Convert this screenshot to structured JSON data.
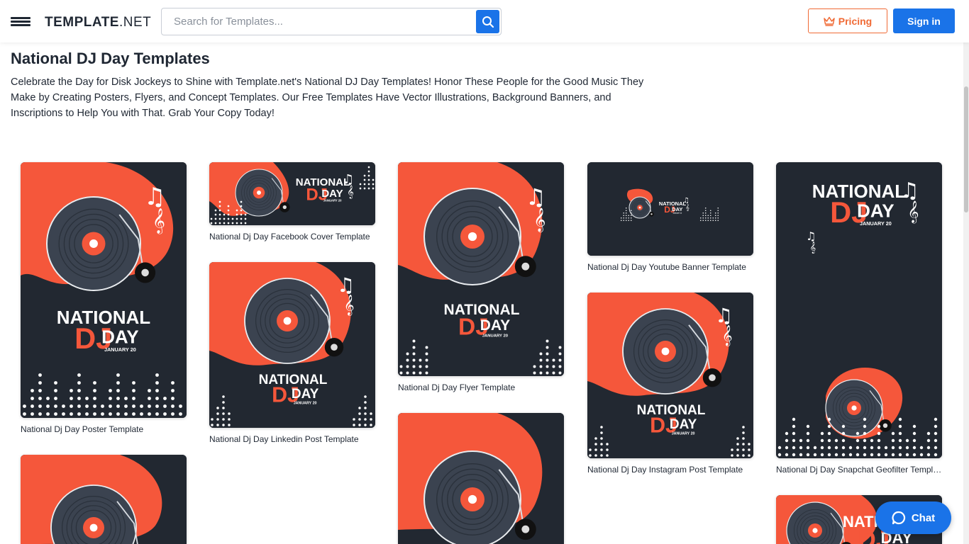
{
  "header": {
    "logo_main": "TEMPLATE",
    "logo_suffix": ".NET",
    "search_placeholder": "Search for Templates...",
    "pricing_label": "Pricing",
    "signin_label": "Sign in"
  },
  "page": {
    "title": "National DJ Day Templates",
    "description": "Celebrate the Day for Disk Jockeys to Shine with Template.net's National DJ Day Templates! Honor These People for the Good Music They Make by Creating Posters, Flyers, and Concept Templates. Our Free Templates Have Vector Illustrations, Background Banners, and Inscriptions to Help You with That. Grab Your Copy Today!"
  },
  "thumb_text": {
    "line1": "NATIONAL",
    "line2": "DJ",
    "line3": "DAY",
    "date": "JANUARY 20"
  },
  "colors": {
    "accent": "#f5573b",
    "dark": "#222831",
    "brand_blue": "#1a73e8",
    "pricing_orange": "#f06a35"
  },
  "cards": [
    {
      "label": "National Dj Day Poster Template"
    },
    {
      "label": "National Dj Day Facebook Cover Template"
    },
    {
      "label": "National Dj Day Linkedin Post Template"
    },
    {
      "label": "National Dj Day Flyer Template"
    },
    {
      "label": "National Dj Day Youtube Banner Template"
    },
    {
      "label": "National Dj Day Instagram Post Template"
    },
    {
      "label": "National Dj Day Snapchat Geofilter Template"
    }
  ],
  "chat": {
    "label": "Chat"
  }
}
